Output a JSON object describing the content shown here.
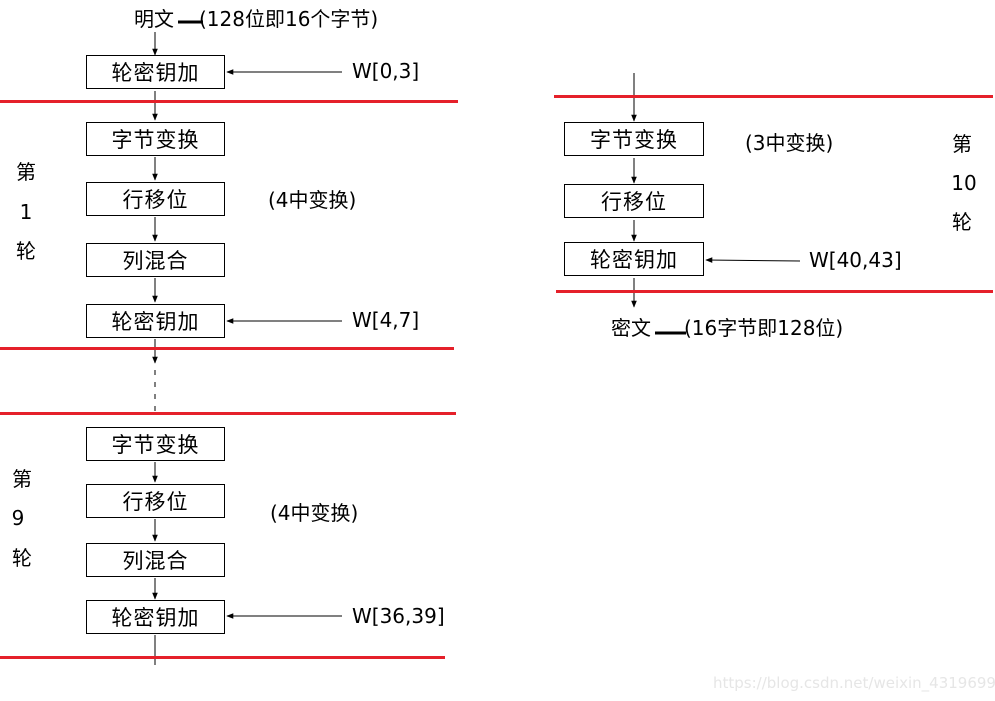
{
  "colors": {
    "round_divider": "#e5202a",
    "stroke": "#000000",
    "watermark": "#e6e6e6"
  },
  "input": {
    "name": "明文",
    "desc": "(128位即16个字节)"
  },
  "output": {
    "name": "密文",
    "desc": "(16字节即128位)"
  },
  "initial": {
    "step": "轮密钥加",
    "key": "W[0,3]"
  },
  "round1": {
    "label": [
      "第",
      "1",
      "轮"
    ],
    "note": "(4中变换)",
    "steps": [
      "字节变换",
      "行移位",
      "列混合",
      "轮密钥加"
    ],
    "key": "W[4,7]"
  },
  "round9": {
    "label": [
      "第",
      "9",
      "轮"
    ],
    "note": "(4中变换)",
    "steps": [
      "字节变换",
      "行移位",
      "列混合",
      "轮密钥加"
    ],
    "key": "W[36,39]"
  },
  "round10": {
    "label": [
      "第",
      "10",
      "轮"
    ],
    "note": "(3中变换)",
    "steps": [
      "字节变换",
      "行移位",
      "轮密钥加"
    ],
    "key": "W[40,43]"
  },
  "watermark": "https://blog.csdn.net/weixin_43196993"
}
